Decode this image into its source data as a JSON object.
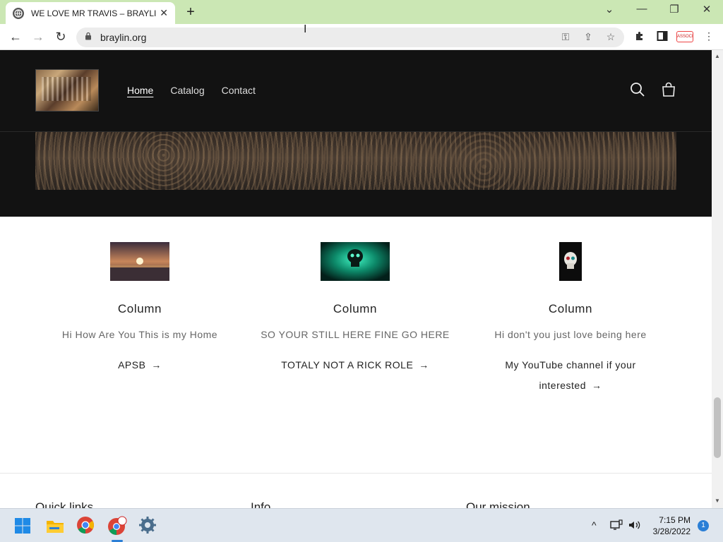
{
  "browser": {
    "tab_title": "WE LOVE MR TRAVIS – BRAYLIN.ORG",
    "tab_close": "✕",
    "new_tab": "+",
    "url": "braylin.org",
    "profile_badge": "ASSOCIA"
  },
  "site": {
    "nav": [
      {
        "label": "Home",
        "active": true
      },
      {
        "label": "Catalog",
        "active": false
      },
      {
        "label": "Contact",
        "active": false
      }
    ]
  },
  "columns": [
    {
      "title": "Column",
      "text": "Hi How Are You This is my Home",
      "link_line1": "APSB",
      "link_line2": ""
    },
    {
      "title": "Column",
      "text": "SO YOUR STILL HERE FINE GO HERE",
      "link_line1": "TOTALY NOT A RICK ROLE",
      "link_line2": ""
    },
    {
      "title": "Column",
      "text": "Hi don't you just love being here",
      "link_line1": "My YouTube channel if your",
      "link_line2": "interested"
    }
  ],
  "footer": {
    "headings": [
      "Quick links",
      "Info",
      "Our mission"
    ]
  },
  "taskbar": {
    "time": "7:15 PM",
    "date": "3/28/2022",
    "notification_count": "1"
  },
  "colors": {
    "header_bg": "#121212",
    "tabstrip_bg": "#cbe7b4",
    "taskbar_bg": "#dfe6ee"
  }
}
